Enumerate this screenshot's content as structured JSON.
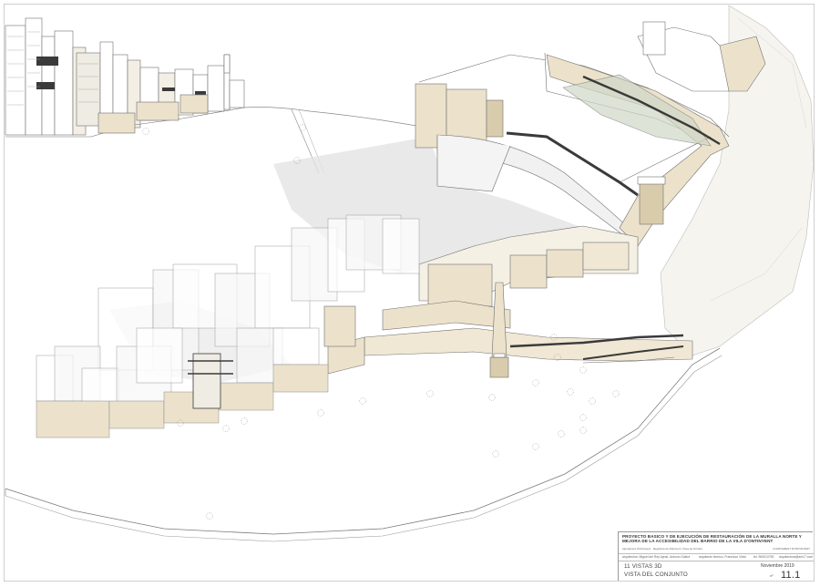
{
  "drawing": {
    "figure_names": [
      "city-skyline",
      "plaza-ground",
      "retaining-walls",
      "chimney-tower",
      "ramps-and-stairs",
      "lower-village-buildings",
      "hillside-slope",
      "trees"
    ],
    "colors": {
      "line": "#6f6f6f",
      "wall_beige": "#ece2cb",
      "wall_beige_dark": "#d9ccad",
      "shadow": "#e7e7e7",
      "ground": "#ffffff",
      "glass": "#efece4",
      "dark_rail": "#3a3a3a",
      "green_planting": "#cfd8c7"
    }
  },
  "title_block": {
    "project": "PROYECTO BASICO Y DE EJECUCIÓN DE RESTAURACIÓN DE LA MURALLA NORTE Y MEJORA DE LA ACCESIBILIDAD DEL BARRIO DE LA VILA D'ONTINYENT",
    "subtitle": "Ajuntament d'Ontinyent · Regidoria de Patrimoni i Àrea de Territori",
    "client": "AJUNTAMENT D'ONTINYENT",
    "architects": "arquitectos:   Miguel del Rey Aynat,   Antonio Gallud",
    "technical": "arquitecto técnico:  Francisco Vidal",
    "phone": "tel.  963010750",
    "email": "arquitectura@am17.com",
    "sheet_name": "11 VISTAS 3D",
    "view_name": "VISTA DEL CONJUNTO",
    "date": "Noviembre 2019",
    "sheet_label": "nº",
    "sheet_number": "11.1"
  }
}
